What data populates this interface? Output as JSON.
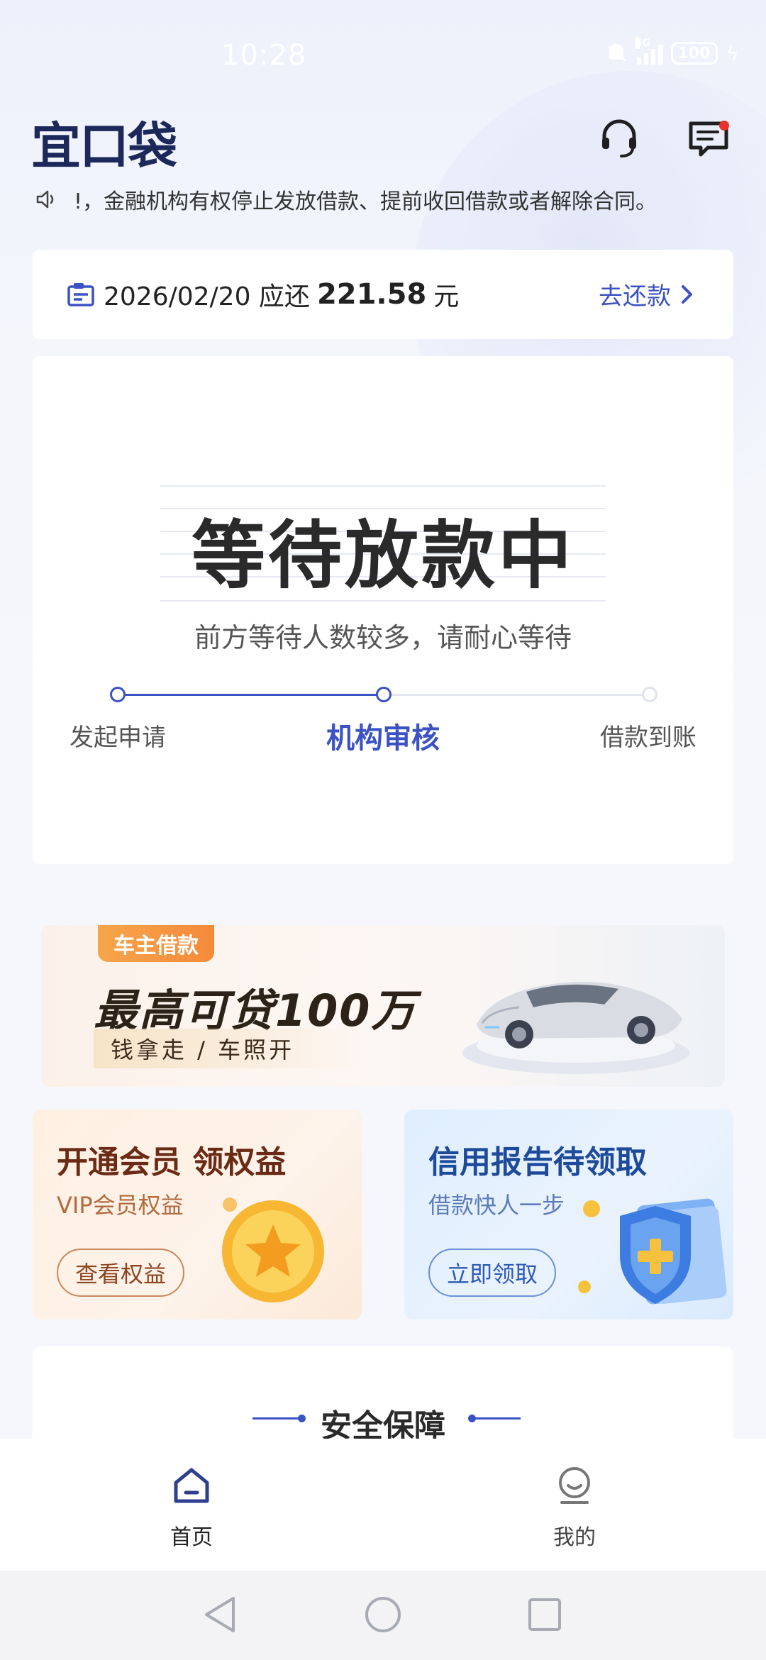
{
  "status_bar": {
    "time": "10:28",
    "network": "5G",
    "battery": "100"
  },
  "header": {
    "logo": "宜口袋",
    "icons": [
      "headset-icon",
      "message-icon"
    ]
  },
  "notice": {
    "text": "!，金融机构有权停止发放借款、提前收回借款或者解除合同。"
  },
  "repay": {
    "date_prefix": "2026/02/20 应还",
    "amount": "221.58",
    "unit": "元",
    "action": "去还款"
  },
  "loan_status": {
    "title": "等待放款中",
    "subtitle": "前方等待人数较多，请耐心等待",
    "steps": [
      {
        "label": "发起申请",
        "state": "done"
      },
      {
        "label": "机构审核",
        "state": "active"
      },
      {
        "label": "借款到账",
        "state": "pending"
      }
    ]
  },
  "banner": {
    "tag": "车主借款",
    "title": "最高可贷100万",
    "subtitle": "钱拿走 / 车照开"
  },
  "promos": {
    "vip": {
      "title": "开通会员 领权益",
      "subtitle": "VIP会员权益",
      "button": "查看权益"
    },
    "credit": {
      "title": "信用报告待领取",
      "subtitle": "借款快人一步",
      "button": "立即领取"
    }
  },
  "security": {
    "title": "安全保障"
  },
  "tabbar": {
    "home": "首页",
    "mine": "我的"
  },
  "colors": {
    "accent": "#3b52c4",
    "brand_dark": "#1c2859"
  }
}
